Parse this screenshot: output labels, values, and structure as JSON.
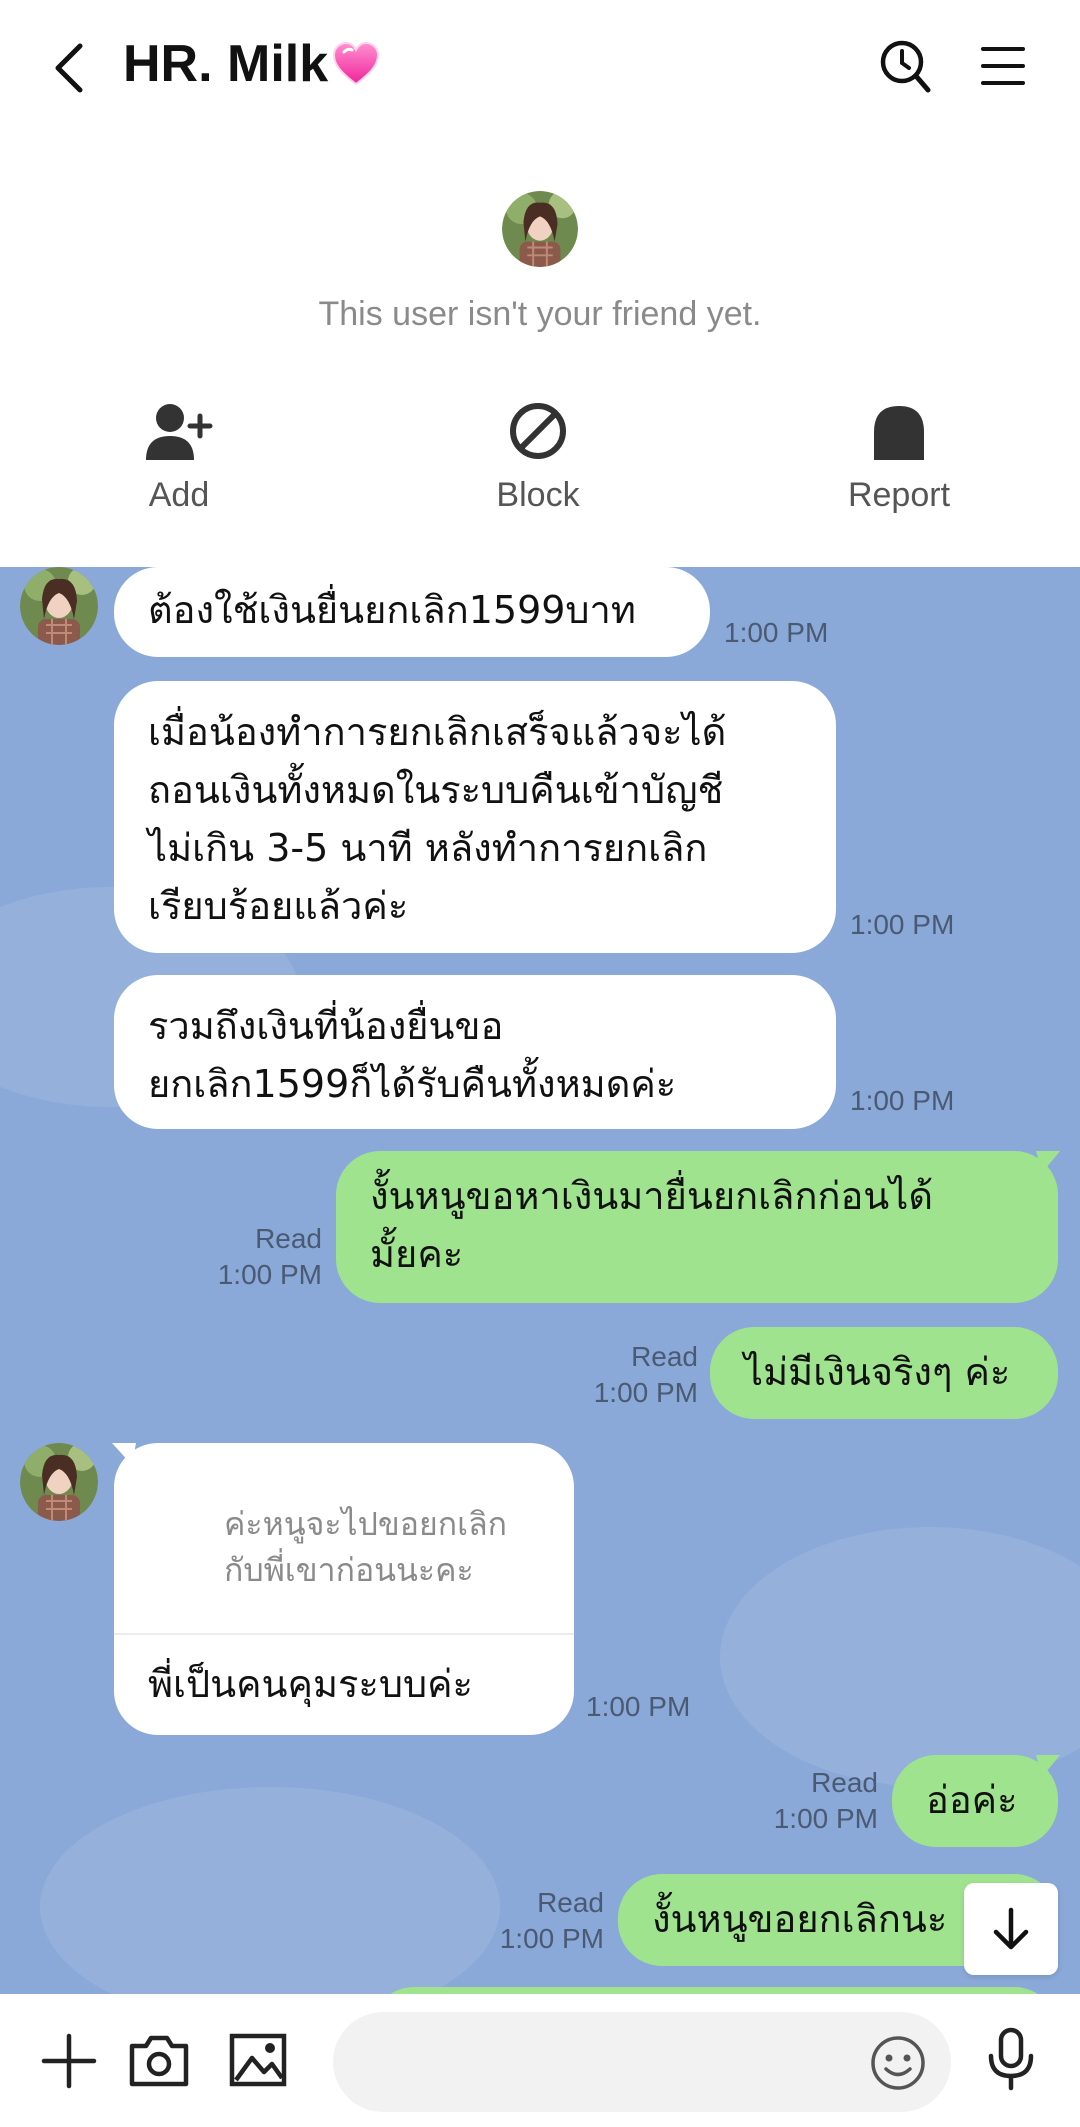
{
  "header": {
    "title": "HR. Milk",
    "back_icon": "chevron-left-icon",
    "title_emoji": "sparkling-heart-icon",
    "search_icon": "clock-search-icon",
    "menu_icon": "hamburger-menu-icon"
  },
  "profile": {
    "notice": "This user isn't your friend yet.",
    "actions": [
      {
        "label": "Add",
        "icon": "add-friend-icon"
      },
      {
        "label": "Block",
        "icon": "block-icon"
      },
      {
        "label": "Report",
        "icon": "report-icon"
      }
    ]
  },
  "messages": [
    {
      "side": "in",
      "lines": [
        "ต้องใช้เงินยื่นยกเลิก1599บาท"
      ],
      "time": "1:00 PM"
    },
    {
      "side": "in",
      "lines": [
        "เมื่อน้องทำการยกเลิกเสร็จแล้วจะได้",
        "ถอนเงินทั้งหมดในระบบคืนเข้าบัญชี",
        "ไม่เกิน 3-5 นาที หลังทำการยกเลิก",
        "เรียบร้อยแล้วค่ะ"
      ],
      "time": "1:00 PM"
    },
    {
      "side": "in",
      "lines": [
        "รวมถึงเงินที่น้องยื่นขอ",
        "ยกเลิก1599ก็ได้รับคืนทั้งหมดค่ะ"
      ],
      "time": "1:00 PM"
    },
    {
      "side": "out",
      "lines": [
        "งั้นหนูขอหาเงินมายื่นยกเลิกก่อนได้",
        "มั้ยคะ"
      ],
      "read": "Read",
      "time": "1:00 PM"
    },
    {
      "side": "out",
      "lines": [
        "ไม่มีเงินจริงๆ ค่ะ"
      ],
      "read": "Read",
      "time": "1:00 PM"
    },
    {
      "side": "in",
      "reply_quote": [
        "ค่ะหนูจะไปขอยกเลิก",
        "กับพี่เขาก่อนนะคะ"
      ],
      "lines": [
        "พี่เป็นคนคุมระบบค่ะ"
      ],
      "time": "1:00 PM"
    },
    {
      "side": "out",
      "lines": [
        "อ่อค่ะ"
      ],
      "read": "Read",
      "time": "1:00 PM"
    },
    {
      "side": "out",
      "lines": [
        "งั้นหนูขอยกเลิกนะ"
      ],
      "read": "Read",
      "time": "1:00 PM"
    }
  ],
  "input": {
    "placeholder": "",
    "plus_icon": "plus-icon",
    "camera_icon": "camera-icon",
    "image_icon": "image-icon",
    "emoji_icon": "emoji-icon",
    "mic_icon": "microphone-icon"
  },
  "scroll_down_icon": "arrow-down-icon",
  "colors": {
    "chat_bg": "#8aa9d8",
    "outgoing_bubble": "#a0e38f",
    "incoming_bubble": "#ffffff"
  }
}
